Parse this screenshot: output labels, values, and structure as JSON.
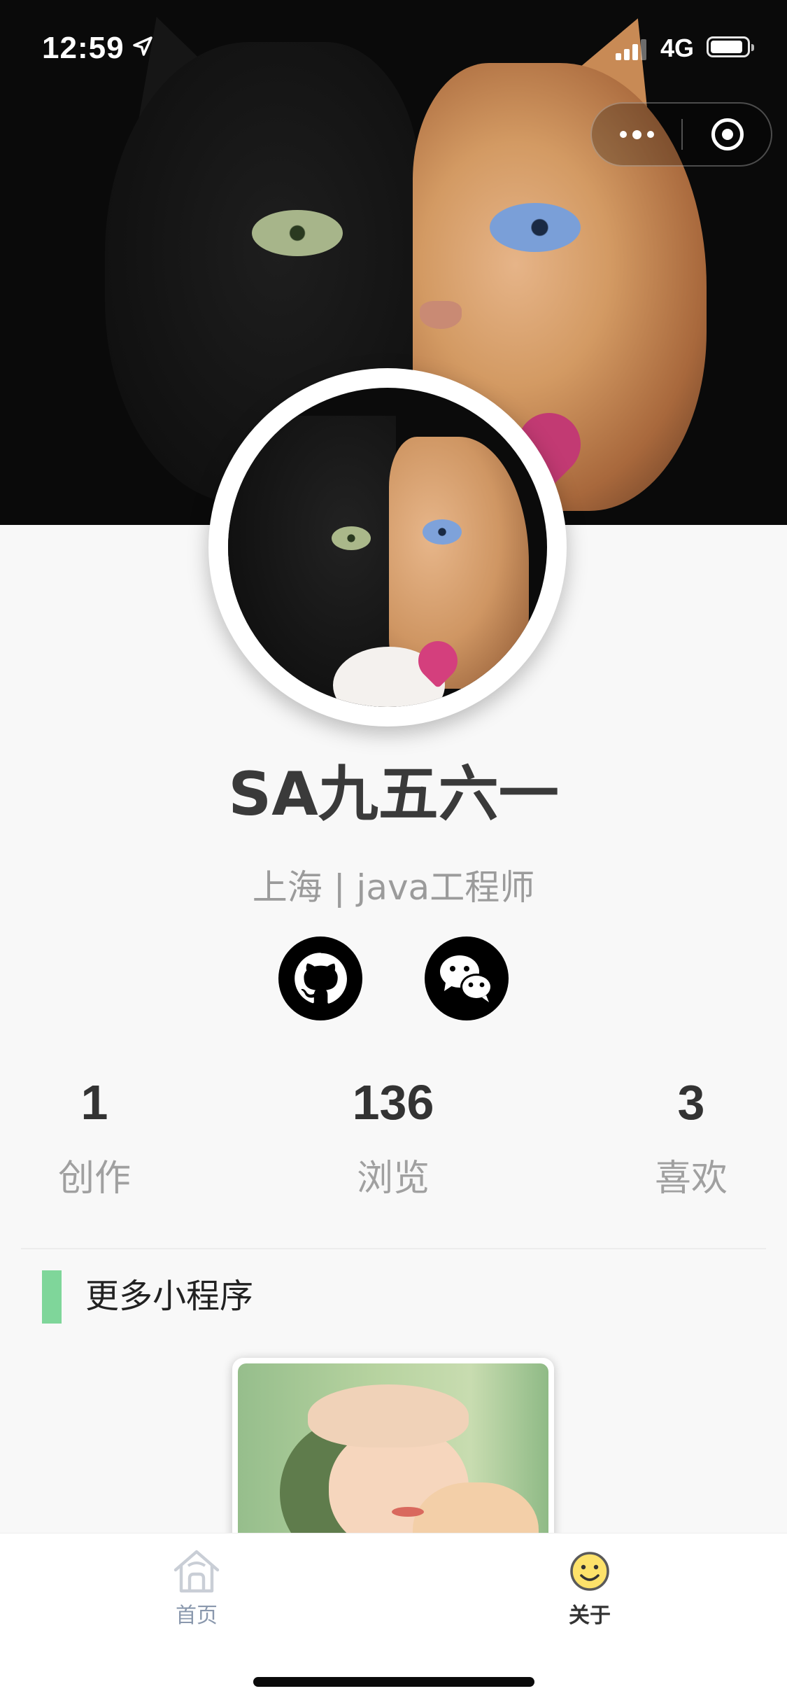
{
  "status_bar": {
    "time": "12:59",
    "network": "4G",
    "battery_level": 0.9,
    "signal_bars": 3
  },
  "capsule": {
    "more_icon": "more-dots-icon",
    "close_icon": "target-circle-icon"
  },
  "profile": {
    "name": "SA九五六一",
    "subtitle": "上海 | java工程师",
    "social": [
      {
        "icon": "github-icon"
      },
      {
        "icon": "wechat-icon"
      }
    ]
  },
  "stats": [
    {
      "value": "1",
      "label": "创作"
    },
    {
      "value": "136",
      "label": "浏览"
    },
    {
      "value": "3",
      "label": "喜欢"
    }
  ],
  "section": {
    "title": "更多小程序",
    "accent_color": "#7fd69a"
  },
  "tabbar": {
    "tabs": [
      {
        "label": "首页",
        "icon": "home-icon",
        "active": false
      },
      {
        "label": "关于",
        "icon": "smiley-icon",
        "active": true
      }
    ]
  }
}
